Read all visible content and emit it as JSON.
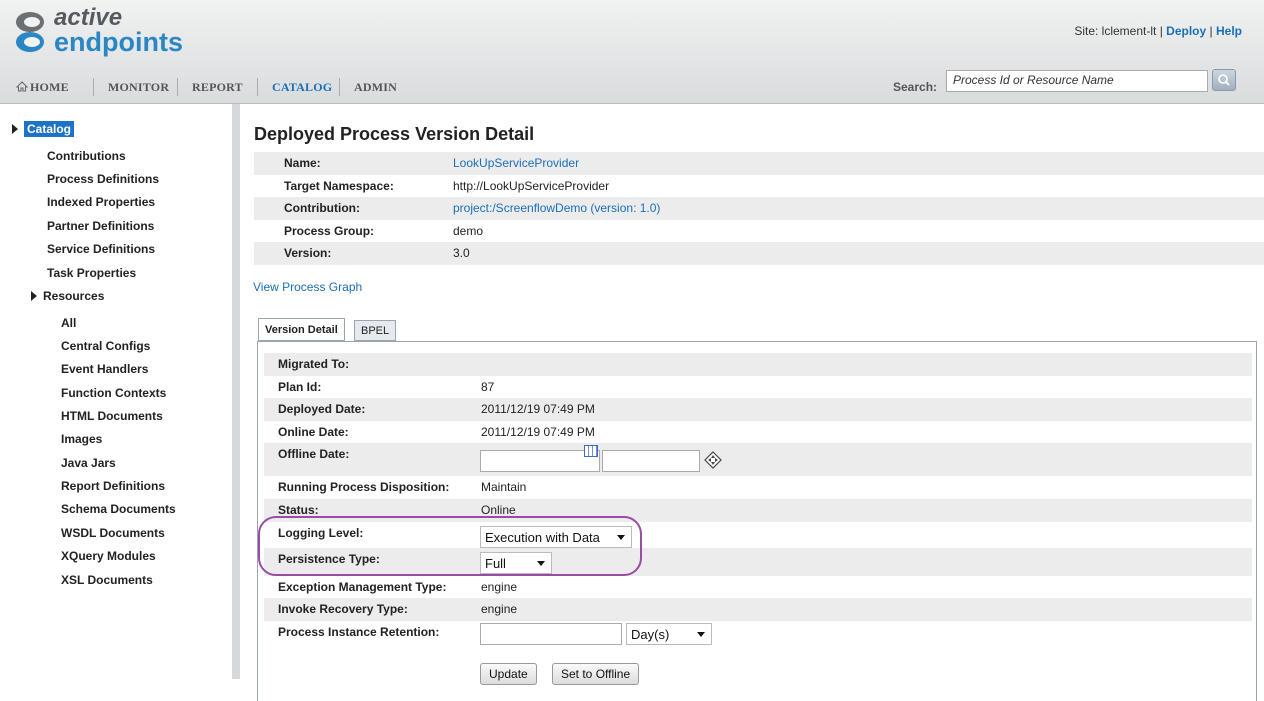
{
  "brand": {
    "line1": "active",
    "line2": "endpoints"
  },
  "site": {
    "site_text": "Site: lclement-lt",
    "sep": "|",
    "deploy": "Deploy",
    "help": "Help"
  },
  "nav": {
    "home": "HOME",
    "monitor": "MONITOR",
    "report": "REPORT",
    "catalog": "CATALOG",
    "admin": "ADMIN",
    "active": "CATALOG"
  },
  "search": {
    "label": "Search:",
    "placeholder": "Process Id or Resource Name",
    "icon": "search-icon"
  },
  "sidebar": {
    "catalog": "Catalog",
    "items": [
      "Contributions",
      "Process Definitions",
      "Indexed Properties",
      "Partner Definitions",
      "Service Definitions",
      "Task Properties"
    ],
    "resources": "Resources",
    "resource_items": [
      "All",
      "Central Configs",
      "Event Handlers",
      "Function Contexts",
      "HTML Documents",
      "Images",
      "Java Jars",
      "Report Definitions",
      "Schema Documents",
      "WSDL Documents",
      "XQuery Modules",
      "XSL Documents"
    ]
  },
  "page": {
    "title": "Deployed Process Version Detail",
    "details": [
      {
        "label": "Name:",
        "value": "LookUpServiceProvider"
      },
      {
        "label": "Target Namespace:",
        "value": "http://LookUpServiceProvider"
      },
      {
        "label": "Contribution:",
        "value": "project:/ScreenflowDemo (version: 1.0)"
      },
      {
        "label": "Process Group:",
        "value": "demo"
      },
      {
        "label": "Version:",
        "value": "3.0"
      }
    ],
    "view_graph": "View Process Graph"
  },
  "tabs": {
    "version_detail": "Version Detail",
    "bpel": "BPEL"
  },
  "version": {
    "migrated_to": {
      "label": "Migrated To:",
      "value": ""
    },
    "plan_id": {
      "label": "Plan Id:",
      "value": "87"
    },
    "deployed_date": {
      "label": "Deployed Date:",
      "value": "2011/12/19 07:49 PM"
    },
    "online_date": {
      "label": "Online Date:",
      "value": "2011/12/19 07:49 PM"
    },
    "offline_date": {
      "label": "Offline Date:",
      "date_value": "",
      "time_value": ""
    },
    "running_disposition": {
      "label": "Running Process Disposition:",
      "value": "Maintain"
    },
    "status": {
      "label": "Status:",
      "value": "Online"
    },
    "logging_level": {
      "label": "Logging Level:",
      "value": "Execution with Data"
    },
    "persistence_type": {
      "label": "Persistence Type:",
      "value": "Full"
    },
    "exception_mgmt": {
      "label": "Exception Management Type:",
      "value": "engine"
    },
    "invoke_recovery": {
      "label": "Invoke Recovery Type:",
      "value": "engine"
    },
    "retention": {
      "label": "Process Instance Retention:",
      "value": "",
      "unit": "Day(s)"
    },
    "update_button": "Update",
    "offline_button": "Set to Offline"
  },
  "colors": {
    "link": "#1b6fb5",
    "highlight": "#9a4ca4",
    "selected": "#1b72c6"
  }
}
